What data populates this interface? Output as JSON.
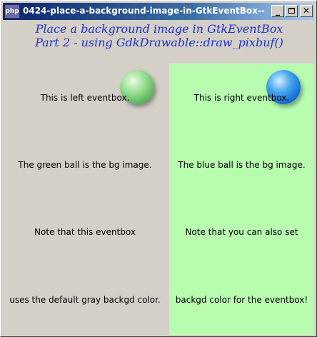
{
  "window": {
    "title": "0424-place-a-background-image-in-GtkEventBox--...",
    "icon_label": "php",
    "buttons": {
      "minimize": "_",
      "close": "✕"
    }
  },
  "heading": {
    "line1": "Place a background image in GtkEventBox",
    "line2": "Part 2 - using GdkDrawable::draw_pixbuf()"
  },
  "left_eventbox": {
    "background_color": "#d4d0c8",
    "ball_icon": "green-ball",
    "lines": [
      "This is left eventbox.",
      "The green ball is the bg image.",
      "Note that this eventbox",
      "uses the default gray backgd color."
    ]
  },
  "right_eventbox": {
    "background_color": "#b8fcb0",
    "ball_icon": "blue-ball",
    "lines": [
      "This is right eventbox.",
      "The blue ball is the bg image.",
      "Note that you can also set",
      "backgd color for the eventbox!"
    ]
  }
}
